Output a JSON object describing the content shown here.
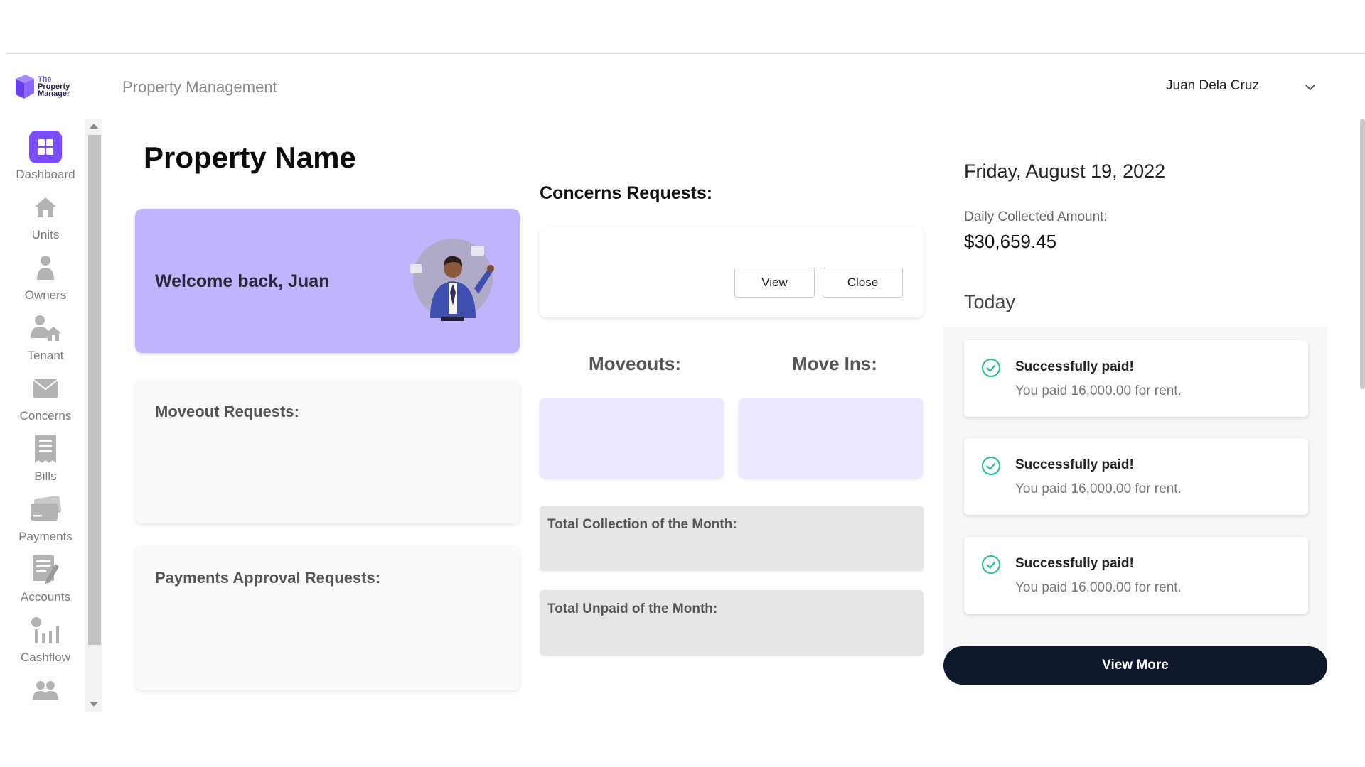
{
  "header": {
    "logo_line1": "The",
    "logo_line2": "Property",
    "logo_line3": "Manager",
    "app_title": "Property Management",
    "user_name": "Juan Dela Cruz"
  },
  "sidebar": {
    "items": [
      {
        "label": "Dashboard",
        "icon": "dashboard-icon"
      },
      {
        "label": "Units",
        "icon": "home-icon"
      },
      {
        "label": "Owners",
        "icon": "person-icon"
      },
      {
        "label": "Tenant",
        "icon": "tenant-icon"
      },
      {
        "label": "Concerns",
        "icon": "mail-icon"
      },
      {
        "label": "Bills",
        "icon": "receipt-icon"
      },
      {
        "label": "Payments",
        "icon": "card-icon"
      },
      {
        "label": "Accounts",
        "icon": "accounts-icon"
      },
      {
        "label": "Cashflow",
        "icon": "cashflow-icon"
      },
      {
        "label": "",
        "icon": "group-icon"
      }
    ]
  },
  "main": {
    "page_title": "Property Name",
    "welcome_text": "Welcome back, Juan",
    "moveout_requests_label": "Moveout Requests:",
    "payments_approval_label": "Payments Approval Requests:",
    "concerns_title": "Concerns Requests:",
    "view_label": "View",
    "close_label": "Close",
    "moveouts_title": "Moveouts:",
    "moveins_title": "Move Ins:",
    "total_collection_label": "Total Collection of the Month:",
    "total_unpaid_label": "Total Unpaid of the Month:"
  },
  "right": {
    "date": "Friday, August 19, 2022",
    "daily_collected_label": "Daily Collected Amount:",
    "daily_collected_value": "$30,659.45",
    "today_label": "Today",
    "payments": [
      {
        "title": "Successfully paid!",
        "subtitle": "You paid 16,000.00 for rent."
      },
      {
        "title": "Successfully paid!",
        "subtitle": "You paid 16,000.00 for rent."
      },
      {
        "title": "Successfully paid!",
        "subtitle": "You paid 16,000.00 for rent."
      }
    ],
    "view_more_label": "View More"
  },
  "colors": {
    "accent": "#7c4dff",
    "welcome_bg": "#c2b3ff",
    "success": "#2bbf9a",
    "dark_button": "#0f172a"
  }
}
